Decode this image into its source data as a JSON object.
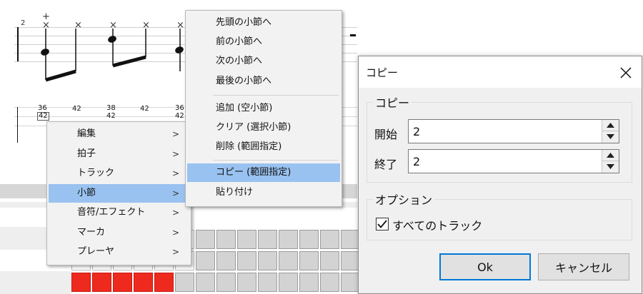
{
  "score": {
    "measure_number": "2",
    "tab_numbers": [
      "36",
      "42",
      "42",
      "38",
      "42",
      "42",
      "36",
      "42"
    ],
    "note_marks": [
      "+",
      "×"
    ]
  },
  "context_menu": {
    "items": [
      {
        "label": "編集",
        "arrow": ">"
      },
      {
        "label": "拍子",
        "arrow": ">"
      },
      {
        "label": "トラック",
        "arrow": ">"
      },
      {
        "label": "小節",
        "arrow": ">"
      },
      {
        "label": "音符/エフェクト",
        "arrow": ">"
      },
      {
        "label": "マーカ",
        "arrow": ">"
      },
      {
        "label": "プレーヤ",
        "arrow": ">"
      }
    ]
  },
  "submenu": {
    "items": [
      {
        "label": "先頭の小節へ"
      },
      {
        "label": "前の小節へ"
      },
      {
        "label": "次の小節へ"
      },
      {
        "label": "最後の小節へ"
      },
      {
        "label": "追加 (空小節)"
      },
      {
        "label": "クリア (選択小節)"
      },
      {
        "label": "削除 (範囲指定)"
      },
      {
        "label": "コピー (範囲指定)"
      },
      {
        "label": "貼り付け"
      }
    ]
  },
  "dialog": {
    "title": "コピー",
    "close_glyph": "×",
    "group_copy": {
      "title": "コピー",
      "start_label": "開始",
      "start_value": "2",
      "end_label": "終了",
      "end_value": "2"
    },
    "group_options": {
      "title": "オプション",
      "all_tracks_label": "すべてのトラック",
      "all_tracks_checked": true
    },
    "ok_label": "Ok",
    "cancel_label": "キャンセル"
  },
  "colors": {
    "menu_highlight": "#99c2f0",
    "grid_red": "#ee2a1f",
    "ok_border": "#0078d7"
  }
}
